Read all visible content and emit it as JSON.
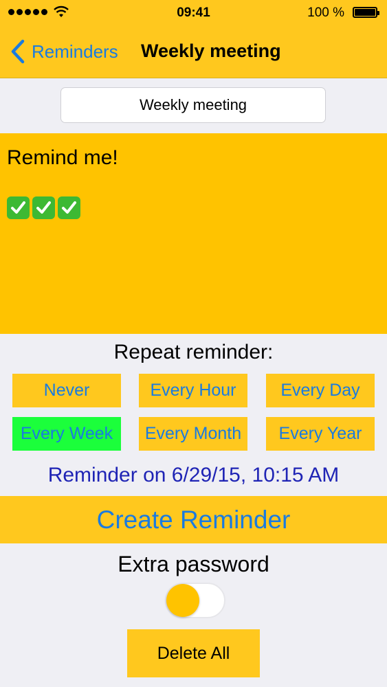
{
  "status_bar": {
    "time": "09:41",
    "battery_percent": "100 %",
    "signal_bars": 5
  },
  "nav": {
    "back_label": "Reminders",
    "title": "Weekly meeting"
  },
  "reminder": {
    "title_value": "Weekly meeting",
    "notes_text": "Remind me!",
    "checkmarks": 3
  },
  "repeat": {
    "label": "Repeat reminder:",
    "options": [
      "Never",
      "Every Hour",
      "Every Day",
      "Every Week",
      "Every Month",
      "Every Year"
    ],
    "selected": "Every Week"
  },
  "reminder_date": "Reminder on 6/29/15, 10:15 AM",
  "create_button": "Create Reminder",
  "extra_password": {
    "label": "Extra password",
    "enabled": false
  },
  "delete_button": "Delete All",
  "colors": {
    "accent_yellow": "#ffc81e",
    "link_blue": "#1a7be0",
    "selected_green": "#1bff3b",
    "date_blue": "#1f24b5"
  },
  "icons": [
    "signal-icon",
    "wifi-icon",
    "battery-icon",
    "back-chevron-icon",
    "check-mark-icon"
  ]
}
